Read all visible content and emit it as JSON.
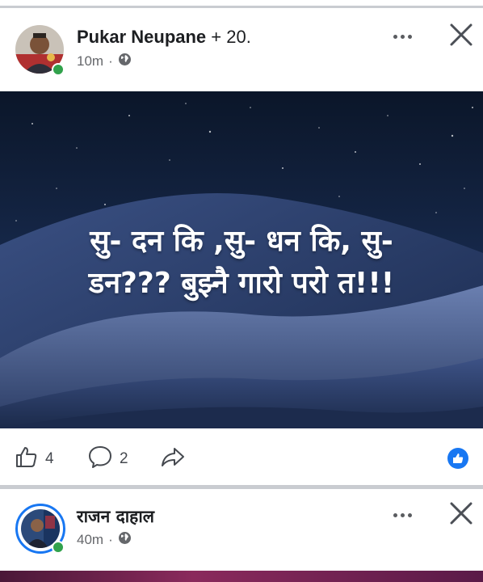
{
  "post1": {
    "author_name": "Pukar Neupane",
    "author_suffix": " + 20.",
    "time": "10m",
    "separator": "·",
    "privacy_icon": "globe-icon",
    "image_text_line1": "सु- दन कि ,सु- धन कि, सु-",
    "image_text_line2": "डन??? बुझ्नै गारो परो त!!!",
    "like_count": "4",
    "comment_count": "2"
  },
  "post2": {
    "author_name": "राजन दाहाल",
    "time": "40m",
    "separator": "·",
    "privacy_icon": "globe-icon"
  },
  "colors": {
    "accent": "#1877f2",
    "online": "#31a24c",
    "muted": "#65676b",
    "sky_top": "#0e1a2e",
    "dune": "#2a3c66"
  }
}
